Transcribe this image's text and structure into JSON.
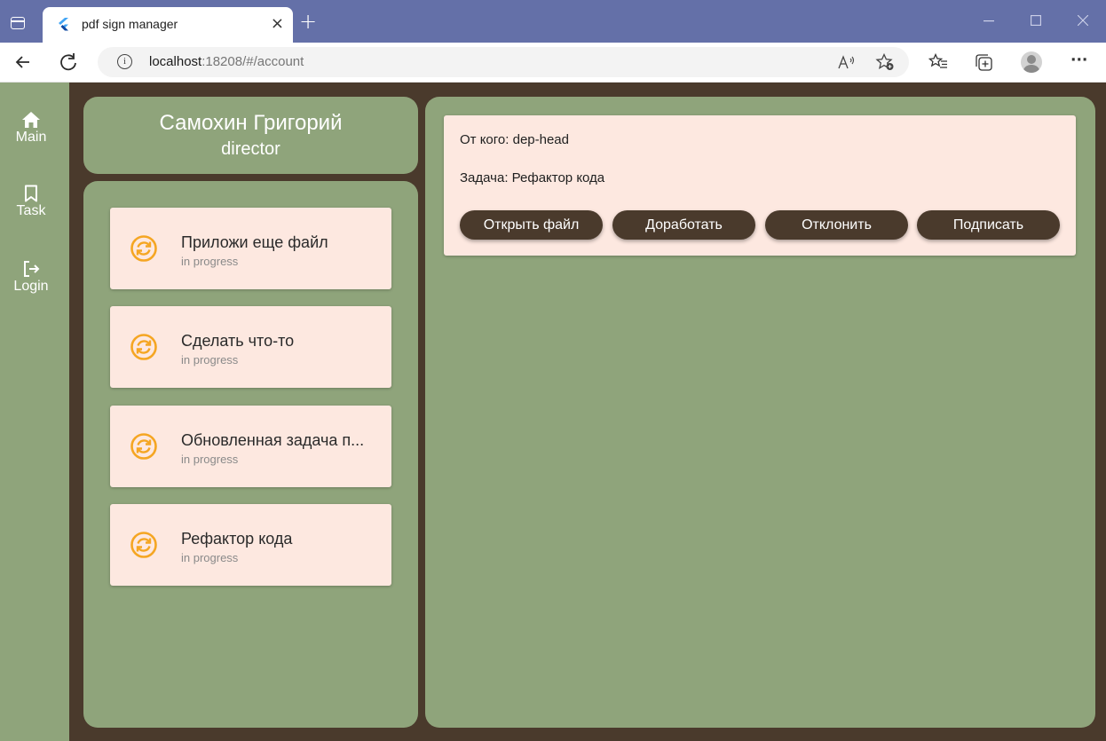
{
  "browser": {
    "tab_title": "pdf sign manager",
    "tab_close": "×",
    "new_tab": "+",
    "url_host": "localhost",
    "url_rest": ":18208/#/account",
    "more_label": "···"
  },
  "rail": {
    "items": [
      {
        "label": "Main",
        "icon": "home-icon"
      },
      {
        "label": "Task",
        "icon": "bookmark-icon"
      },
      {
        "label": "Login",
        "icon": "logout-icon"
      }
    ]
  },
  "profile": {
    "name": "Самохин Григорий",
    "role": "director"
  },
  "tasks": [
    {
      "title": "Приложи еще файл",
      "status": "in progress",
      "icon": "sync-icon"
    },
    {
      "title": "Сделать что-то",
      "status": "in progress",
      "icon": "sync-icon"
    },
    {
      "title": "Обновленная задача п...",
      "status": "in progress",
      "icon": "sync-icon"
    },
    {
      "title": "Рефактор кода",
      "status": "in progress",
      "icon": "sync-icon"
    }
  ],
  "detail": {
    "from_line": "От кого: dep-head",
    "task_line": "Задача: Рефактор кода",
    "buttons": [
      "Открыть файл",
      "Доработать",
      "Отклонить",
      "Подписать"
    ]
  },
  "colors": {
    "green_panel": "#8fa47b",
    "dark_brown": "#4a3a2c",
    "card_pink": "#fde8e0",
    "accent_orange": "#f5a623",
    "titlebar": "#6470a8"
  }
}
